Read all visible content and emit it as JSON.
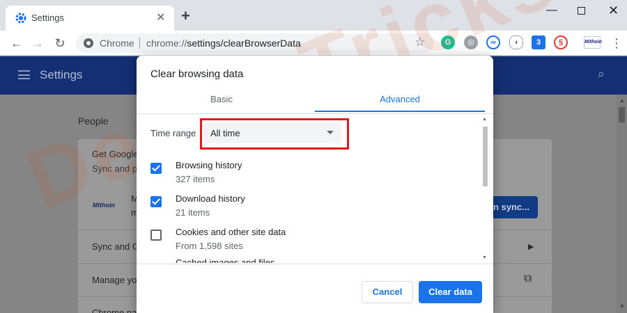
{
  "browser": {
    "tab_title": "Settings",
    "tab_close": "✕",
    "new_tab": "+",
    "window_controls": {
      "minimize": "—",
      "close": "✕"
    },
    "nav": {
      "back": "←",
      "forward": "→",
      "reload": "↻"
    },
    "omnibox": {
      "scheme_label": "Chrome",
      "url_prefix": "chrome://",
      "url_path": "settings/clearBrowserData",
      "star": "☆"
    },
    "extensions": [
      {
        "name": "grammarly-icon",
        "glyph": "G"
      },
      {
        "name": "globe-icon",
        "glyph": "◎"
      },
      {
        "name": "infinity-icon",
        "glyph": "∞"
      },
      {
        "name": "mouse-icon",
        "glyph": "◖"
      },
      {
        "name": "calendar-icon",
        "glyph": "3"
      },
      {
        "name": "spiral-icon",
        "glyph": "§"
      }
    ],
    "profile_label": "Mithoin",
    "menu": "⋮"
  },
  "settings": {
    "header_title": "Settings",
    "search_icon": "🔍",
    "section_people": "People",
    "card": {
      "row1_title": "Get Google",
      "row1_sub": "Sync and p",
      "profile_logo": "Mithoin",
      "profile_initial": "M",
      "profile_initial_2": "m",
      "sync_button": "n sync...",
      "row3": "Sync and G",
      "row4": "Manage yo",
      "row5": "Chrome na"
    }
  },
  "watermark": "DeviceTricks",
  "dialog": {
    "title": "Clear browsing data",
    "tabs": {
      "basic": "Basic",
      "advanced": "Advanced"
    },
    "time_range": {
      "label": "Time range",
      "value": "All time"
    },
    "options": [
      {
        "title": "Browsing history",
        "subtitle": "327 items",
        "checked": true
      },
      {
        "title": "Download history",
        "subtitle": "21 items",
        "checked": true
      },
      {
        "title": "Cookies and other site data",
        "subtitle": "From 1,598 sites",
        "checked": false
      }
    ],
    "clipped_option": "Cached images and files",
    "buttons": {
      "cancel": "Cancel",
      "confirm": "Clear data"
    }
  },
  "colors": {
    "accent": "#1a73e8",
    "highlight": "#e0191f",
    "header_blue": "#142f74"
  }
}
